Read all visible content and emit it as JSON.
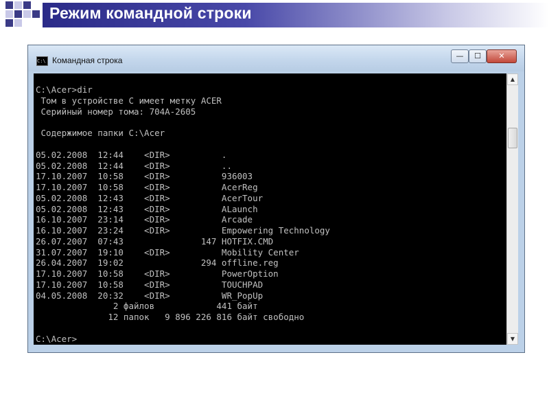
{
  "slide": {
    "title": "Режим командной строки"
  },
  "window": {
    "title": "Командная строка",
    "icon_text": "C:\\",
    "controls": {
      "minimize": "—",
      "maximize": "☐",
      "close": "✕"
    }
  },
  "console": {
    "lines": [
      "C:\\Acer>dir",
      " Том в устройстве C имеет метку ACER",
      " Серийный номер тома: 704A-2605",
      "",
      " Содержимое папки C:\\Acer",
      "",
      "05.02.2008  12:44    <DIR>          .",
      "05.02.2008  12:44    <DIR>          ..",
      "17.10.2007  10:58    <DIR>          936003",
      "17.10.2007  10:58    <DIR>          AcerReg",
      "05.02.2008  12:43    <DIR>          AcerTour",
      "05.02.2008  12:43    <DIR>          ALaunch",
      "16.10.2007  23:14    <DIR>          Arcade",
      "16.10.2007  23:24    <DIR>          Empowering Technology",
      "26.07.2007  07:43               147 HOTFIX.CMD",
      "31.07.2007  19:10    <DIR>          Mobility Center",
      "26.04.2007  19:02               294 offline.reg",
      "17.10.2007  10:58    <DIR>          PowerOption",
      "17.10.2007  10:58    <DIR>          TOUCHPAD",
      "04.05.2008  20:32    <DIR>          WR_PopUp",
      "               2 файлов            441 байт",
      "              12 папок   9 896 226 816 байт свободно",
      "",
      "C:\\Acer>"
    ]
  },
  "colors": {
    "header_dark": "#2b2b88",
    "console_bg": "#000000",
    "console_text": "#c0c0c0",
    "titlebar": "#c4d7ec"
  },
  "icons": {
    "app": "console-icon",
    "scroll_up": "arrow-up-icon",
    "scroll_down": "arrow-down-icon"
  }
}
